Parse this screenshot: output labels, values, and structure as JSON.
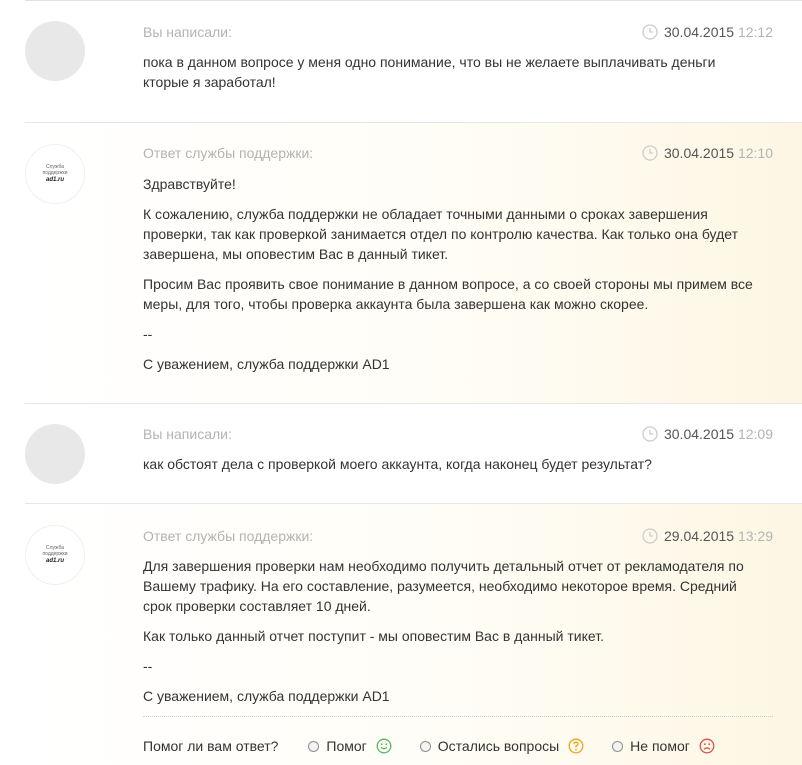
{
  "messages": [
    {
      "author": "Вы написали:",
      "date": "30.04.2015",
      "time": "12:12",
      "paragraphs": [
        "пока в данном вопросе у меня одно понимание, что вы не желаете выплачивать деньги\nкторые я заработал!"
      ]
    },
    {
      "author": "Ответ службы поддержки:",
      "date": "30.04.2015",
      "time": "12:10",
      "paragraphs": [
        "Здравствуйте!",
        "К сожалению, служба поддержки не обладает точными данными о сроках завершения\nпроверки, так как проверкой занимается отдел по контролю качества. Как только она будет\nзавершена, мы оповестим Вас в данный тикет.",
        "Просим Вас проявить свое понимание в данном вопросе, а со своей стороны мы примем все\nмеры, для того, чтобы проверка аккаунта была завершена как можно скорее.",
        "--",
        "С уважением, служба поддержки AD1"
      ]
    },
    {
      "author": "Вы написали:",
      "date": "30.04.2015",
      "time": "12:09",
      "paragraphs": [
        "как обстоят дела с проверкой моего аккаунта, когда наконец будет результат?"
      ]
    },
    {
      "author": "Ответ службы поддержки:",
      "date": "29.04.2015",
      "time": "13:29",
      "paragraphs": [
        "Для завершения проверки нам необходимо получить детальный отчет от рекламодателя по\nВашему трафику. На его составление, разумеется, необходимо некоторое время. Средний\nсрок проверки составляет 10 дней.",
        "Как только данный отчет поступит - мы оповестим Вас в данный тикет.",
        "--",
        "С уважением, служба поддержки AD1"
      ]
    }
  ],
  "support_logo": {
    "line1": "Служба",
    "line2": "поддержки",
    "brand": "ad1.ru"
  },
  "feedback": {
    "question": "Помог ли вам ответ?",
    "options": [
      {
        "label": "Помог",
        "icon": "smile-icon",
        "color": "#5cb85c"
      },
      {
        "label": "Остались вопросы",
        "icon": "question-icon",
        "color": "#e6a817"
      },
      {
        "label": "Не помог",
        "icon": "sad-icon",
        "color": "#d9534f"
      }
    ]
  },
  "colors": {
    "muted": "#b3b3b3",
    "text": "#333333",
    "support_bg": "#fdf6e3"
  }
}
